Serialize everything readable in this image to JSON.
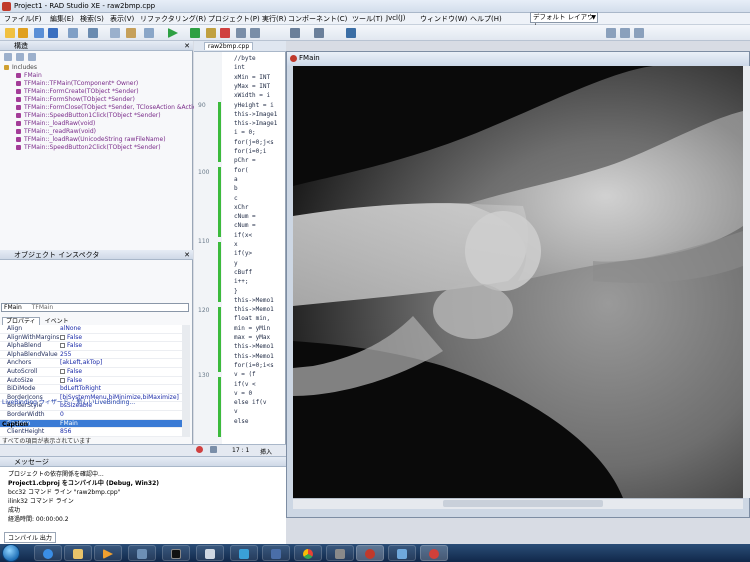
{
  "window": {
    "title": "Project1 - RAD Studio XE - raw2bmp.cpp"
  },
  "menu": [
    "ファイル(F)",
    "編集(E)",
    "検索(S)",
    "表示(V)",
    "リファクタリング(R)",
    "プロジェクト(P)",
    "実行(R)",
    "コンポーネント(C)",
    "ツール(T)",
    "Jvcl(J)",
    "ウィンドウ(W)",
    "ヘルプ(H)"
  ],
  "layout_combo": {
    "value": "デフォルト レイアウト"
  },
  "structure_panel": {
    "title": "構造",
    "root": "Includes",
    "items": [
      "FMain",
      "TFMain::TFMain(TComponent* Owner)",
      "TFMain::FormCreate(TObject *Sender)",
      "TFMain::FormShow(TObject *Sender)",
      "TFMain::FormClose(TObject *Sender, TCloseAction &Action)",
      "TFMain::SpeedButton1Click(TObject *Sender)",
      "TFMain::_loadRaw(void)",
      "TFMain::_readRaw(void)",
      "TFMain::_loadRaw(UnicodeString rawFileName)",
      "TFMain::SpeedButton2Click(TObject *Sender)"
    ]
  },
  "inspector": {
    "title": "オブジェクト インスペクタ",
    "selected_object": "FMain",
    "selected_type": "TFMain",
    "tabs": [
      "プロパティ",
      "イベント"
    ],
    "properties": [
      {
        "name": "Align",
        "value": "alNone"
      },
      {
        "name": "AlignWithMargins",
        "value": "False"
      },
      {
        "name": "AlphaBlend",
        "value": "False"
      },
      {
        "name": "AlphaBlendValue",
        "value": "255"
      },
      {
        "name": "Anchors",
        "value": "[akLeft,akTop]"
      },
      {
        "name": "AutoScroll",
        "value": "False"
      },
      {
        "name": "AutoSize",
        "value": "False"
      },
      {
        "name": "BiDiMode",
        "value": "bdLeftToRight"
      },
      {
        "name": "BorderIcons",
        "value": "[biSystemMenu,biMinimize,biMaximize]"
      },
      {
        "name": "BorderStyle",
        "value": "bsSizeable"
      },
      {
        "name": "BorderWidth",
        "value": "0"
      },
      {
        "name": "Caption",
        "value": "FMain"
      },
      {
        "name": "ClientHeight",
        "value": "856"
      }
    ],
    "footer": "LiveBinding ウィザード... 新しいLiveBinding...",
    "caption_label": "Caption",
    "hint": "すべての項目が表示されています"
  },
  "editor": {
    "tab": "raw2bmp.cpp",
    "line_numbers": [
      "90",
      "100",
      "110",
      "120",
      "130"
    ],
    "code_lines": [
      "//byte",
      "int",
      "xMin = INT",
      "yMax = INT",
      "xWidth = i",
      "yHeight = i",
      "this->Image1",
      "this->Image1",
      "i = 0;",
      "for(j=0;j<s",
      "  for(i=0;i",
      "    pChr =",
      "    for(",
      "      a",
      "      b",
      "      c",
      "    xChr",
      "    cNum =",
      "    cNum =",
      "    if(x<",
      "      x",
      "    if(y>",
      "      y",
      "    cBuff",
      "  i++;",
      "}",
      "this->Memo1",
      "this->Memo1",
      "float min,",
      "min = yMin",
      "max = yMax",
      "this->Memo1",
      "this->Memo1",
      "for(i=0;i<s",
      "  v = (f",
      "  if(v <",
      "    v = 0",
      "  else if(v",
      "    v",
      "  else"
    ]
  },
  "bottom_toolbar": {
    "position": "17 : 1",
    "mode": "挿入"
  },
  "messages": {
    "header": "メッセージ",
    "lines": [
      "プロジェクトの依存関係を確認中...",
      "Project1.cbproj をコンパイル中 (Debug, Win32)",
      "bcc32 コマンド ライン \"raw2bmp.cpp\"",
      "ilink32 コマンド ライン",
      "成功",
      "経過時間: 00:00:00.2"
    ],
    "tab": "コンパイル 出力"
  },
  "xray_window": {
    "title": "FMain"
  },
  "taskbar": {
    "apps": [
      "IE",
      "explorer",
      "media",
      "terminal",
      "calculator",
      "tools",
      "editor",
      "chrome",
      "app1",
      "app2",
      "app3",
      "app4"
    ]
  }
}
